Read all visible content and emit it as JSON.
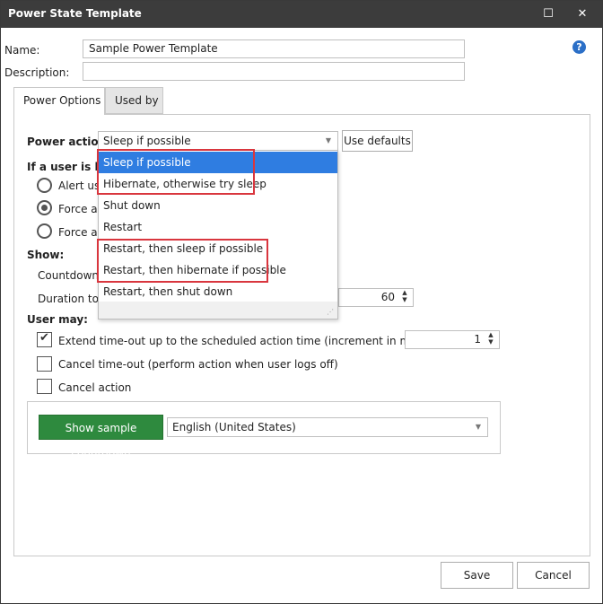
{
  "window": {
    "title": "Power State Template",
    "maximize_glyph": "☐",
    "close_glyph": "✕"
  },
  "form": {
    "name_label": "Name:",
    "name_value": "Sample Power Template",
    "description_label": "Description:",
    "description_value": "",
    "help_glyph": "?"
  },
  "tabs": [
    {
      "label": "Power Options",
      "active": true
    },
    {
      "label": "Used by",
      "active": false
    }
  ],
  "power_options": {
    "power_action_label": "Power action:",
    "power_action_value": "Sleep if possible",
    "use_defaults_label": "Use defaults",
    "if_user_logged_label": "If a user is logg",
    "radios": [
      {
        "label": "Alert use",
        "checked": false
      },
      {
        "label": "Force ac",
        "checked": true
      },
      {
        "label": "Force ac",
        "checked": false
      }
    ],
    "show_label": "Show:",
    "countdown_label": "Countdown f",
    "duration_label": "Duration to c",
    "duration_value": "60",
    "user_may_label": "User may:",
    "checks": [
      {
        "label": "Extend time-out up to the scheduled action time (increment in minutes)",
        "checked": true
      },
      {
        "label": "Cancel time-out (perform action when user logs off)",
        "checked": false
      },
      {
        "label": "Cancel action",
        "checked": false
      }
    ],
    "extend_value": "1",
    "show_sample_label": "Show sample countdown",
    "language_value": "English (United States)"
  },
  "dropdown": {
    "items": [
      "Sleep if possible",
      "Hibernate, otherwise try sleep",
      "Shut down",
      "Restart",
      "Restart, then sleep if possible",
      "Restart, then hibernate if possible",
      "Restart, then shut down"
    ],
    "selected_index": 0,
    "highlighted_indices": [
      0,
      1,
      4,
      5
    ],
    "highlight_color": "#d9363e",
    "selection_color": "#2f7de1"
  },
  "footer": {
    "save_label": "Save",
    "cancel_label": "Cancel"
  },
  "colors": {
    "titlebar": "#3c3c3c",
    "green_button": "#2e8a3e",
    "help_icon": "#2b6fc7"
  }
}
